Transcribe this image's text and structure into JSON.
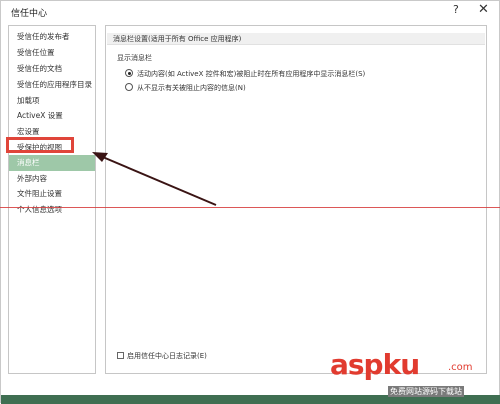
{
  "window": {
    "title": "信任中心",
    "help_glyph": "?",
    "close_glyph": "✕"
  },
  "sidebar": {
    "items": [
      {
        "label": "受信任的发布者"
      },
      {
        "label": "受信任位置"
      },
      {
        "label": "受信任的文档"
      },
      {
        "label": "受信任的应用程序目录"
      },
      {
        "label": "加载项"
      },
      {
        "label": "ActiveX 设置"
      },
      {
        "label": "宏设置"
      },
      {
        "label": "受保护的视图"
      },
      {
        "label": "消息栏"
      },
      {
        "label": "外部内容"
      },
      {
        "label": "文件阻止设置"
      },
      {
        "label": "个人信息选项"
      }
    ],
    "selected_index": 8
  },
  "panel": {
    "section_header": "消息栏设置(适用于所有 Office 应用程序)",
    "show_label": "显示消息栏",
    "options": [
      {
        "label": "活动内容(如 ActiveX 控件和宏)被阻止时在所有应用程序中显示消息栏(S)",
        "selected": true
      },
      {
        "label": "从不显示有关被阻止内容的信息(N)",
        "selected": false
      }
    ],
    "logging_checkbox_label": "启用信任中心日志记录(E)",
    "logging_checked": false
  },
  "watermark": {
    "main": "aspku",
    "dotcom": ".com",
    "sub": "免费网站源码下载站"
  },
  "colors": {
    "selected_bg": "#9ec8a8",
    "annotation_red": "#e0453a",
    "watermark_red": "#e13b2f"
  }
}
